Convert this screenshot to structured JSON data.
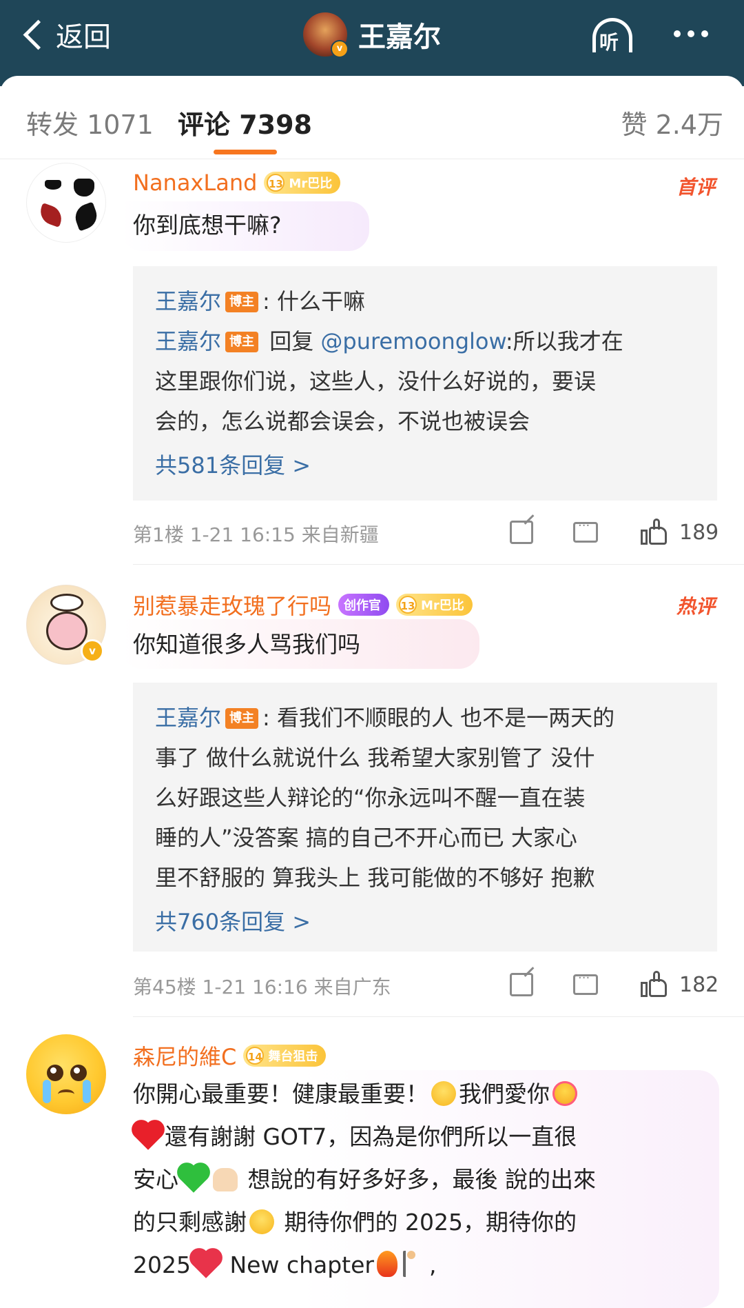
{
  "nav": {
    "back_label": "返回",
    "title": "王嘉尔",
    "verified_mark": "v",
    "listen_label": "听"
  },
  "tabs": {
    "repost": "转发 1071",
    "comments": "评论 7398",
    "likes": "赞 2.4万",
    "active": "comments",
    "accent_color": "#f7761f"
  },
  "comments": [
    {
      "username": "NanaxLand",
      "badges": [
        {
          "type": "level",
          "level": "13",
          "label": "Mr巴比"
        }
      ],
      "tag": "首评",
      "text": "你到底想干嘛?",
      "replies": [
        {
          "author": "王嘉尔",
          "role": "博主",
          "content": ": 什么干嘛"
        },
        {
          "author": "王嘉尔",
          "role": "博主",
          "prefix": "回复 ",
          "mention": "@puremoonglow",
          "content": ":所以我才在",
          "content_line2": "这里跟你们说，这些人，没什么好说的，要误",
          "content_line3": "会的，怎么说都会误会，不说也被误会"
        }
      ],
      "more_replies": "共581条回复 >",
      "floor": "第1楼",
      "date": "1-21 16:15",
      "location": "来自新疆",
      "likes": "189"
    },
    {
      "username": "别惹暴走玫瑰了行吗",
      "badges": [
        {
          "type": "creator",
          "label": "创作官"
        },
        {
          "type": "level",
          "level": "13",
          "label": "Mr巴比"
        }
      ],
      "tag": "热评",
      "text": "你知道很多人骂我们吗",
      "replies": [
        {
          "author": "王嘉尔",
          "role": "博主",
          "content": ": 看我们不顺眼的人 也不是一两天的",
          "lines": [
            "事了 做什么就说什么 我希望大家别管了 没什",
            "么好跟这些人辩论的“你永远叫不醒一直在装",
            "睡的人”没答案 搞的自己不开心而已 大家心",
            "里不舒服的 算我头上 我可能做的不够好 抱歉"
          ]
        }
      ],
      "more_replies": "共760条回复 >",
      "floor": "第45楼",
      "date": "1-21 16:16",
      "location": "来自广东",
      "likes": "182"
    },
    {
      "username": "森尼的維C",
      "badges": [
        {
          "type": "level",
          "level": "14",
          "label": "舞台狙击"
        }
      ],
      "text_lines": [
        "你開心最重要！健康最重要！",
        "我們愛你",
        "還有謝謝 GOT7，因為是你們所以一直很",
        "安心",
        "想說的有好多好多，最後 說的出來",
        "的只剩感謝",
        "期待你們的 2025，期待你的",
        "2025",
        "New chapter"
      ]
    }
  ],
  "icons": [
    "back-chevron-icon",
    "listen-headphone-icon",
    "more-dots-icon",
    "share-icon",
    "comment-icon",
    "like-thumb-icon"
  ]
}
